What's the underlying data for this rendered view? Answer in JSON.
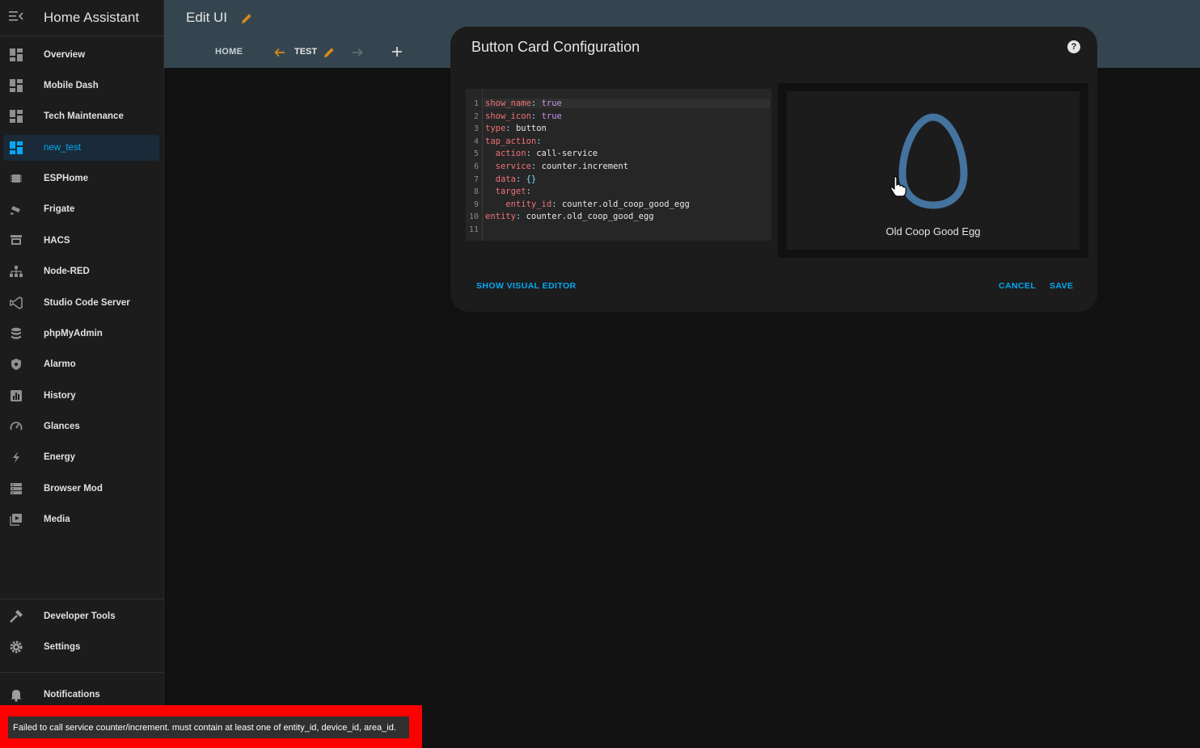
{
  "app": {
    "title": "Home Assistant"
  },
  "sidebar": {
    "items": [
      {
        "label": "Overview",
        "icon": "dashboard-icon"
      },
      {
        "label": "Mobile Dash",
        "icon": "dashboard-icon"
      },
      {
        "label": "Tech Maintenance",
        "icon": "dashboard-icon"
      },
      {
        "label": "new_test",
        "icon": "dashboard-icon",
        "active": true
      },
      {
        "label": "ESPHome",
        "icon": "chip-icon"
      },
      {
        "label": "Frigate",
        "icon": "cctv-icon"
      },
      {
        "label": "HACS",
        "icon": "hacs-icon"
      },
      {
        "label": "Node-RED",
        "icon": "sitemap-icon"
      },
      {
        "label": "Studio Code Server",
        "icon": "vscode-icon"
      },
      {
        "label": "phpMyAdmin",
        "icon": "database-icon"
      },
      {
        "label": "Alarmo",
        "icon": "shield-icon"
      },
      {
        "label": "History",
        "icon": "chart-box-icon"
      },
      {
        "label": "Glances",
        "icon": "gauge-icon"
      },
      {
        "label": "Energy",
        "icon": "lightning-bolt-icon"
      },
      {
        "label": "Browser Mod",
        "icon": "server-icon"
      },
      {
        "label": "Media",
        "icon": "play-box-icon"
      }
    ],
    "developer_tools": "Developer Tools",
    "settings": "Settings",
    "notifications": "Notifications"
  },
  "topbar": {
    "title": "Edit UI",
    "tabs": {
      "home": "HOME",
      "test": "TEST"
    }
  },
  "dialog": {
    "title": "Button Card Configuration",
    "code_lines": [
      {
        "n": "1",
        "key": "show_name",
        "value": "true",
        "value_type": "bool"
      },
      {
        "n": "2",
        "key": "show_icon",
        "value": "true",
        "value_type": "bool"
      },
      {
        "n": "3",
        "key": "type",
        "value": "button",
        "value_type": "str"
      },
      {
        "n": "4",
        "key": "tap_action",
        "value": "",
        "value_type": "none"
      },
      {
        "n": "5",
        "key": "  action",
        "value": "call-service",
        "value_type": "str"
      },
      {
        "n": "6",
        "key": "  service",
        "value": "counter.increment",
        "value_type": "str"
      },
      {
        "n": "7",
        "key": "  data",
        "value": "{}",
        "value_type": "punct"
      },
      {
        "n": "8",
        "key": "  target",
        "value": "",
        "value_type": "none"
      },
      {
        "n": "9",
        "key": "    entity_id",
        "value": "counter.old_coop_good_egg",
        "value_type": "str"
      },
      {
        "n": "10",
        "key": "entity",
        "value": "counter.old_coop_good_egg",
        "value_type": "str"
      },
      {
        "n": "11",
        "key": "",
        "value": "",
        "value_type": "none"
      }
    ],
    "preview": {
      "name": "Old Coop Good Egg",
      "icon": "egg-outline-icon",
      "icon_color": "#44739e"
    },
    "show_visual_editor": "SHOW VISUAL EDITOR",
    "cancel": "CANCEL",
    "save": "SAVE"
  },
  "toast": {
    "message": "Failed to call service counter/increment. must contain at least one of entity_id, device_id, area_id."
  },
  "colors": {
    "accent": "#03a9f4",
    "header": "#35454f",
    "warning_outline": "#ff0000"
  }
}
